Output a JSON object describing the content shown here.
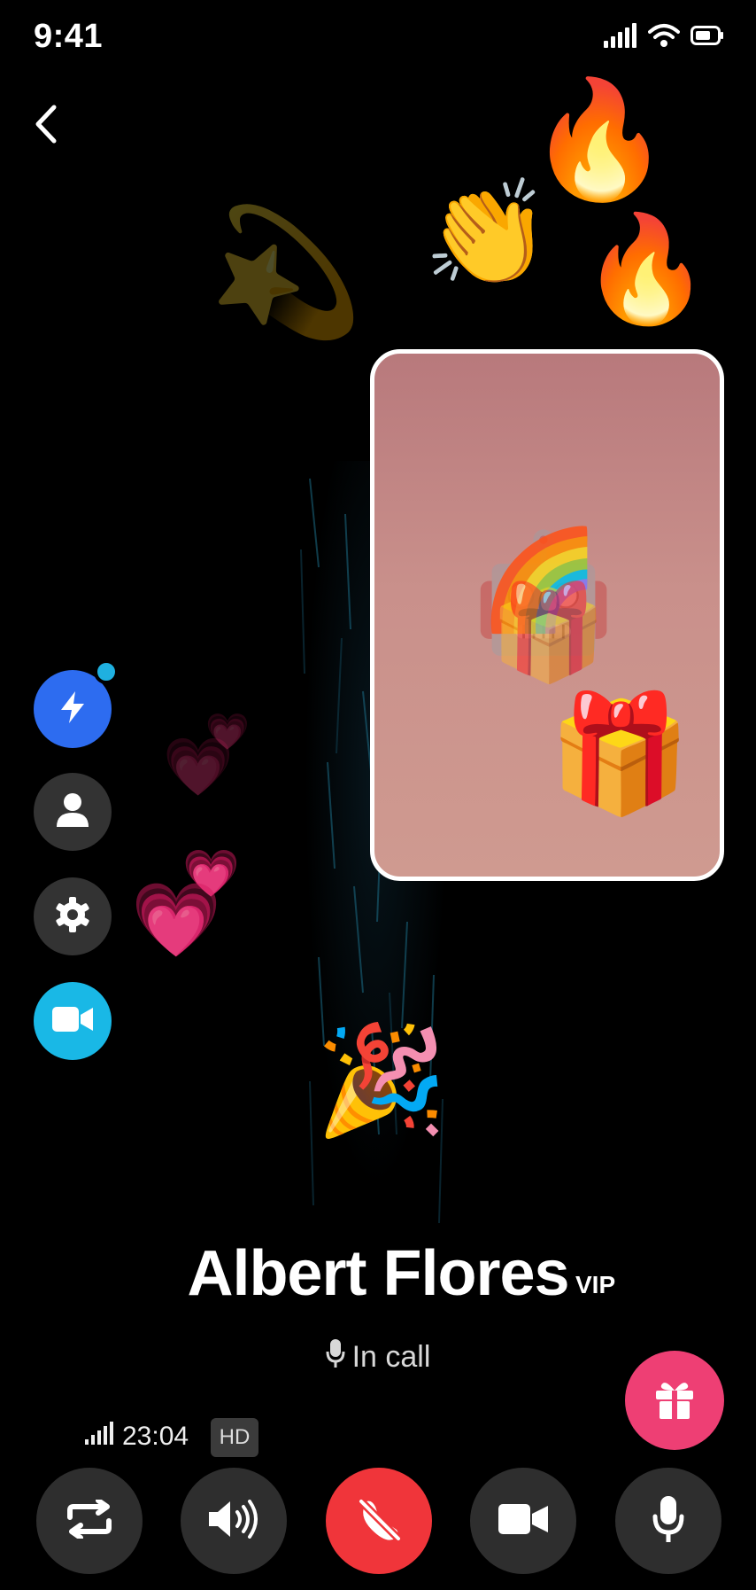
{
  "status_bar": {
    "time": "9:41"
  },
  "contact": {
    "name": "Albert Flores",
    "badge": "VIP"
  },
  "call": {
    "status": "In call",
    "duration": "23:04",
    "quality": "HD"
  },
  "icons": {
    "back": "chevron-left-icon",
    "side_buttons": [
      "lightning-icon",
      "person-icon",
      "gear-icon",
      "video-camera-icon"
    ],
    "controls": [
      "switch-camera-icon",
      "speaker-icon",
      "end-call-icon",
      "video-icon",
      "microphone-icon"
    ],
    "gift": "gift-icon"
  },
  "colors": {
    "background": "#000000",
    "side_primary": "#2d6cf0",
    "side_video": "#19b8e6",
    "side_neutral": "#333333",
    "gift": "#ee3f74",
    "end_call": "#f0353a",
    "control": "#2e2e2e",
    "badge_dot": "#1fb0e0"
  }
}
